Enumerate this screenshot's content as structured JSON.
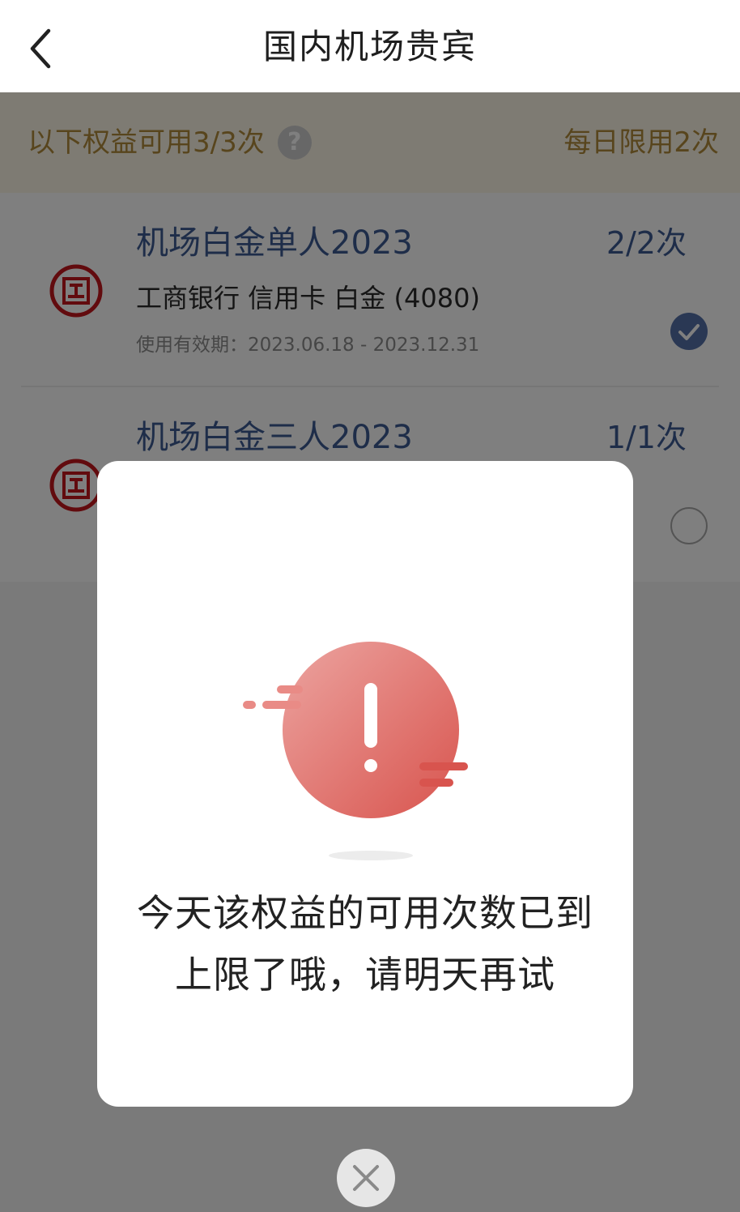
{
  "header": {
    "title": "国内机场贵宾",
    "back_icon": "chevron-left-icon"
  },
  "notice": {
    "left_text": "以下权益可用3/3次",
    "help_symbol": "?",
    "right_text": "每日限用2次"
  },
  "benefits": [
    {
      "title": "机场白金单人2023",
      "count": "2/2次",
      "card_info": "工商银行 信用卡 白金 (4080)",
      "validity": "使用有效期：2023.06.18 - 2023.12.31",
      "selected": true
    },
    {
      "title": "机场白金三人2023",
      "count": "1/1次",
      "selected": false
    }
  ],
  "modal": {
    "icon": "exclamation-alert-icon",
    "message": "今天该权益的可用次数已到上限了哦，请明天再试"
  },
  "close_icon": "close-x-icon",
  "colors": {
    "accent_blue": "#3c5a92",
    "notice_gold": "#b08a3a",
    "icbc_red": "#c4161c",
    "alert_red": "#e06a64"
  }
}
